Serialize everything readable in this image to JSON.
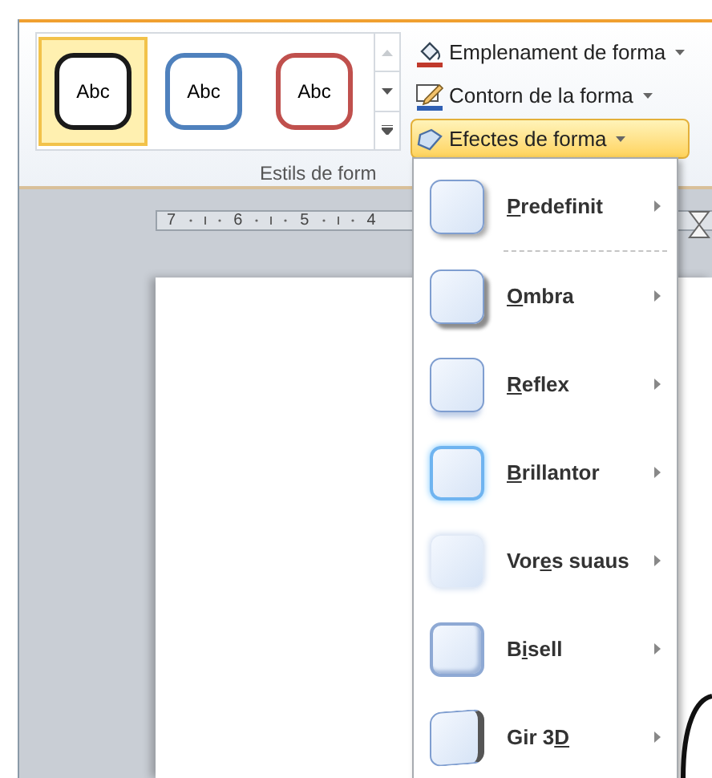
{
  "ribbon": {
    "gallery": {
      "items": [
        {
          "label": "Abc",
          "color": "#1a1a1a",
          "selected": true
        },
        {
          "label": "Abc",
          "color": "#4f81bd",
          "selected": false
        },
        {
          "label": "Abc",
          "color": "#c0504d",
          "selected": false
        }
      ]
    },
    "commands": [
      {
        "label": "Emplenament de forma",
        "kind": "fill",
        "highlighted": false
      },
      {
        "label": "Contorn de la forma",
        "kind": "outline",
        "highlighted": false
      },
      {
        "label": "Efectes de forma",
        "kind": "effects",
        "highlighted": true
      }
    ],
    "group_label": "Estils de form"
  },
  "ruler": {
    "labels": [
      "7",
      "6",
      "5",
      "4"
    ]
  },
  "menu": {
    "items": [
      {
        "kind": "preset",
        "key": "P",
        "after": "redefinit"
      },
      {
        "kind": "shadow",
        "key": "O",
        "after": "mbra"
      },
      {
        "kind": "reflection",
        "key": "R",
        "after": "eflex"
      },
      {
        "kind": "glow",
        "key": "B",
        "after": "rillantor"
      },
      {
        "kind": "soft",
        "before": "Vor",
        "key": "e",
        "after": "s suaus"
      },
      {
        "kind": "bevel",
        "before": "B",
        "key": "i",
        "after": "sell"
      },
      {
        "kind": "rotation",
        "before": "Gir 3",
        "key": "D"
      }
    ]
  }
}
